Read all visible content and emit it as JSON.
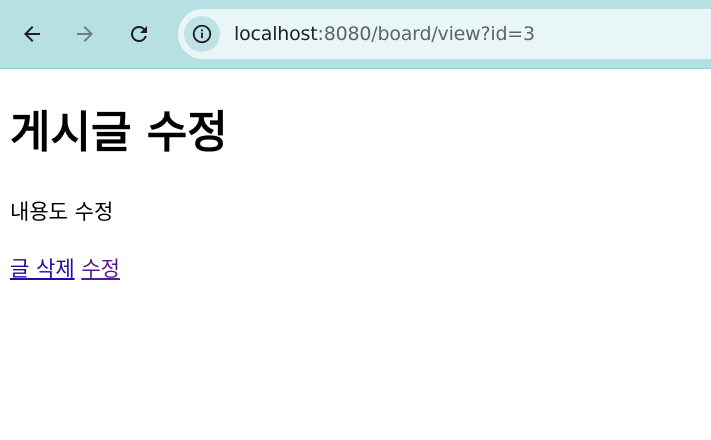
{
  "browser": {
    "url_host": "localhost",
    "url_rest": ":8080/board/view?id=3",
    "colors": {
      "toolbar": "#b7e0e4",
      "omnibox": "#e9f6f7"
    },
    "icons": {
      "back": "arrow-left-icon",
      "forward": "arrow-right-icon",
      "reload": "reload-icon",
      "site_info": "info-icon"
    }
  },
  "page": {
    "title": "게시글 수정",
    "content": "내용도 수정",
    "links": {
      "delete_label": "글 삭제",
      "edit_label": "수정"
    },
    "colors": {
      "link": "#1a0dab",
      "visited_link": "#551a8b"
    }
  }
}
